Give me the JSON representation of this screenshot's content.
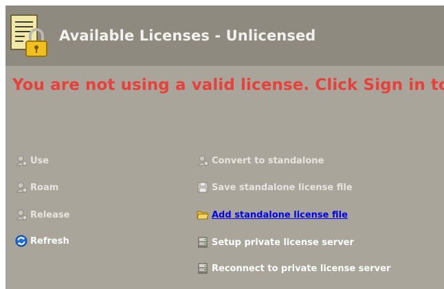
{
  "header": {
    "title": "Available Licenses - Unlicensed",
    "icon": "license-document-lock-icon"
  },
  "warning": {
    "text": "You are not using a valid license. Click Sign in to retrieve",
    "color": "#e8403a"
  },
  "actions_left": [
    {
      "label": "Use",
      "icon": "user-license-icon",
      "enabled": false
    },
    {
      "label": "Roam",
      "icon": "user-license-icon",
      "enabled": false
    },
    {
      "label": "Release",
      "icon": "user-license-icon",
      "enabled": false
    },
    {
      "label": "Refresh",
      "icon": "refresh-icon",
      "enabled": true
    }
  ],
  "actions_right": [
    {
      "label": "Convert to standalone",
      "icon": "user-license-icon",
      "enabled": false
    },
    {
      "label": "Save standalone license file",
      "icon": "floppy-disk-icon",
      "enabled": false
    },
    {
      "label": "Add standalone license file",
      "icon": "folder-open-icon",
      "enabled": true,
      "link": true
    },
    {
      "label": "Setup private license server",
      "icon": "server-icon",
      "enabled": true
    },
    {
      "label": "Reconnect to private license server",
      "icon": "server-icon",
      "enabled": true
    }
  ],
  "colors": {
    "background": "#aaa59a",
    "header_background": "#8e8a7f",
    "link": "#0000ee"
  }
}
